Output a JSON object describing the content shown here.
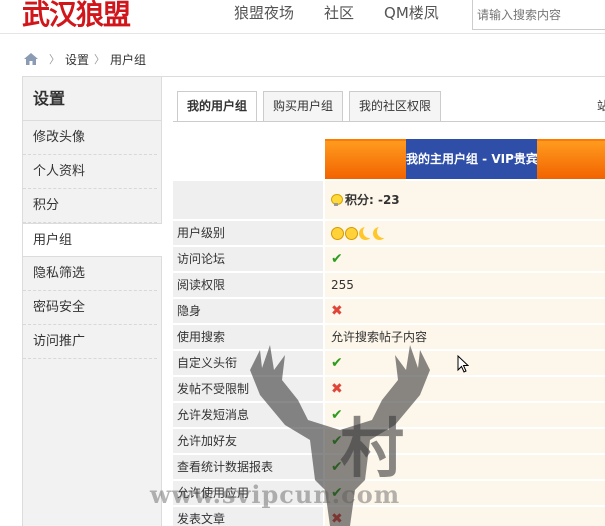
{
  "header": {
    "logo": "武汉狼盟",
    "nav": [
      "狼盟夜场",
      "社区",
      "QM楼凤"
    ],
    "search_placeholder": "请输入搜索内容"
  },
  "breadcrumb": {
    "items": [
      "设置",
      "用户组"
    ]
  },
  "sidebar": {
    "title": "设置",
    "items": [
      "修改头像",
      "个人资料",
      "积分",
      "用户组",
      "隐私筛选",
      "密码安全",
      "访问推广"
    ],
    "active_index": 3
  },
  "tabs": {
    "items": [
      "我的用户组",
      "购买用户组",
      "我的社区权限"
    ],
    "active_index": 0,
    "side_text": "站"
  },
  "table": {
    "header_label": "我的主用户组 - VIP贵宾",
    "points_label": "积分: -23",
    "rows": [
      {
        "label": "用户级别",
        "type": "icons"
      },
      {
        "label": "访问论坛",
        "type": "check"
      },
      {
        "label": "阅读权限",
        "type": "text",
        "value": "255"
      },
      {
        "label": "隐身",
        "type": "cross"
      },
      {
        "label": "使用搜索",
        "type": "text",
        "value": "允许搜索帖子内容"
      },
      {
        "label": "自定义头衔",
        "type": "check"
      },
      {
        "label": "发帖不受限制",
        "type": "cross"
      },
      {
        "label": "允许发短消息",
        "type": "check"
      },
      {
        "label": "允许加好友",
        "type": "check"
      },
      {
        "label": "查看统计数据报表",
        "type": "check"
      },
      {
        "label": "允许使用应用",
        "type": "check"
      },
      {
        "label": "发表文章",
        "type": "cross"
      }
    ]
  },
  "icons": {
    "check": "✔",
    "cross": "✖"
  },
  "watermark": {
    "text": "www.svipcun.com",
    "cun": "村"
  },
  "colors": {
    "logo": "#d0161b",
    "header_bar": "#f26300",
    "header_label_bg": "#2f4ea8",
    "check": "#2e9c1e",
    "cross": "#e0453a"
  }
}
